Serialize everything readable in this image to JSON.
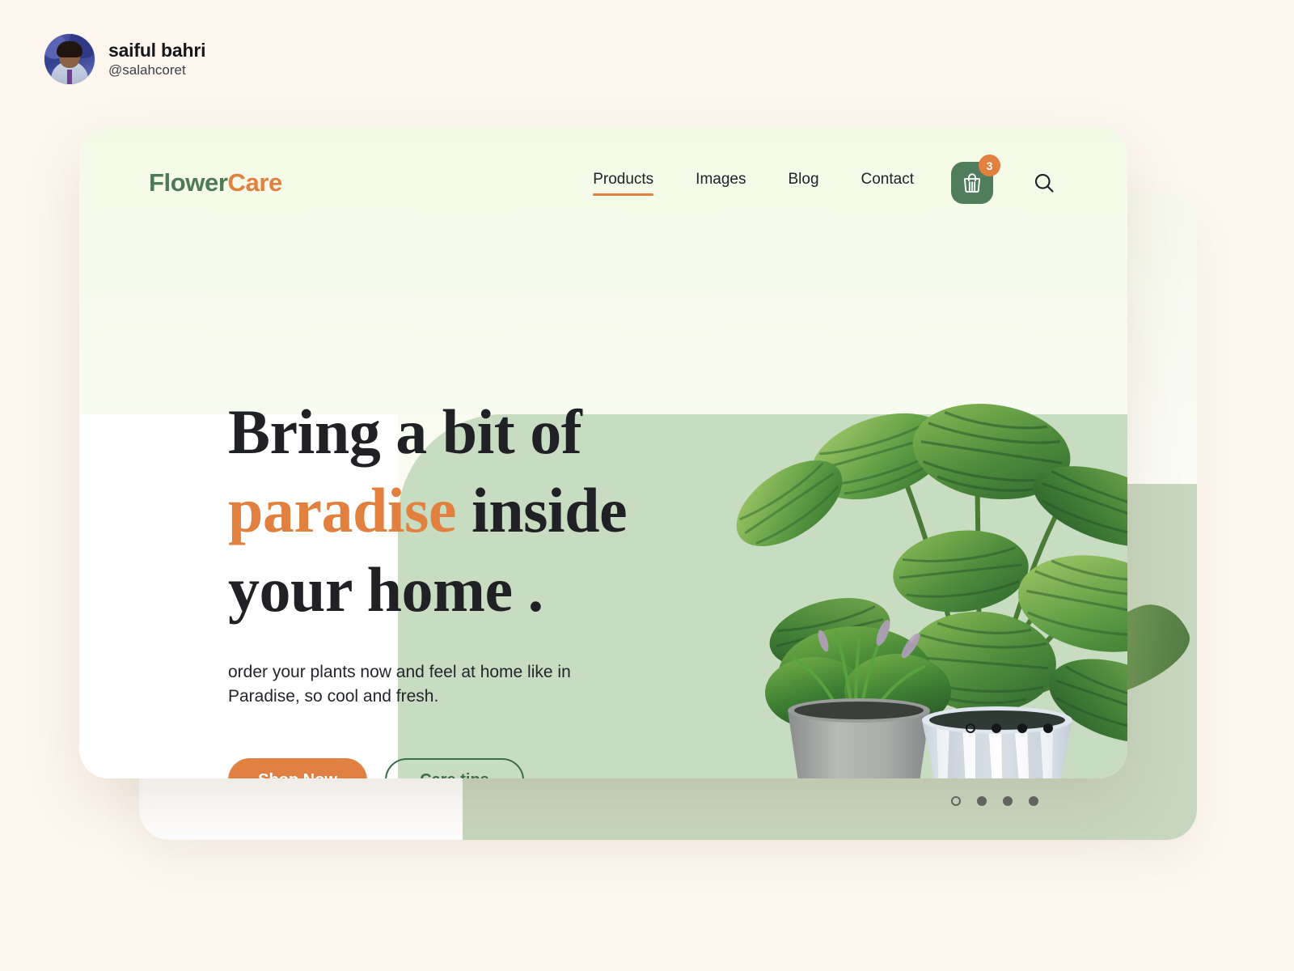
{
  "attribution": {
    "name": "saiful bahri",
    "handle": "@salahcoret",
    "avatar_alt": "profile-photo"
  },
  "brand": {
    "name_part1": "Flower",
    "name_part2": "Care",
    "color_green": "#4f7a55",
    "color_orange": "#e2813f"
  },
  "nav": {
    "links": [
      {
        "label": "Products",
        "active": true
      },
      {
        "label": "Images",
        "active": false
      },
      {
        "label": "Blog",
        "active": false
      },
      {
        "label": "Contact",
        "active": false
      }
    ],
    "cart": {
      "icon": "shopping-bag-icon",
      "badge_count": "3"
    },
    "search": {
      "icon": "search-icon"
    }
  },
  "hero": {
    "headline_line1": "Bring  a bit of",
    "headline_line2_accent": "paradise",
    "headline_line2_rest": " inside",
    "headline_line3": "your home .",
    "subtext": "order your plants now and feel at home like in Paradise, so cool and fresh.",
    "primary_cta": "Shop Now",
    "secondary_cta": "Care tips"
  },
  "carousel": {
    "dots": [
      "active",
      "inactive",
      "inactive",
      "inactive"
    ]
  },
  "theme": {
    "page_background": "#fdf7f0",
    "card_background": "#f4f9e8",
    "panel_green": "#c7dcc0",
    "panel_white": "#ffffff",
    "accent_orange": "#e08043",
    "accent_green": "#4f7d5e",
    "text_dark": "#1f2125"
  }
}
